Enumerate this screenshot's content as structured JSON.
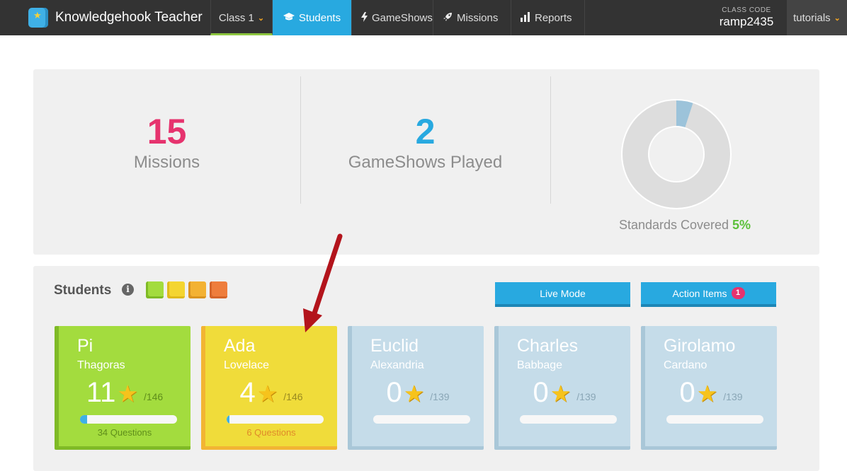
{
  "app": {
    "title": "Knowledgehook Teacher"
  },
  "nav": {
    "class_label": "Class 1",
    "students": "Students",
    "gameshows": "GameShows",
    "missions": "Missions",
    "reports": "Reports",
    "class_code_label": "CLASS CODE",
    "class_code": "ramp2435",
    "tutorials": "tutorials"
  },
  "stats": {
    "missions_count": "15",
    "missions_label": "Missions",
    "gameshows_count": "2",
    "gameshows_label": "GameShows Played",
    "standards_label": "Standards Covered",
    "standards_pct": "5%",
    "standards_fraction": 0.05
  },
  "students": {
    "title": "Students",
    "live_mode": "Live Mode",
    "action_items": "Action Items",
    "action_items_count": "1",
    "cards": [
      {
        "first": "Pi",
        "last": "Thagoras",
        "score": "11",
        "total": "/146",
        "progress": 0.075,
        "questions": "34 Questions",
        "color": "green"
      },
      {
        "first": "Ada",
        "last": "Lovelace",
        "score": "4",
        "total": "/146",
        "progress": 0.027,
        "questions": "6 Questions",
        "color": "yellow"
      },
      {
        "first": "Euclid",
        "last": "Alexandria",
        "score": "0",
        "total": "/139",
        "progress": 0,
        "questions": "",
        "color": "blue"
      },
      {
        "first": "Charles",
        "last": "Babbage",
        "score": "0",
        "total": "/139",
        "progress": 0,
        "questions": "",
        "color": "blue"
      },
      {
        "first": "Girolamo",
        "last": "Cardano",
        "score": "0",
        "total": "/139",
        "progress": 0,
        "questions": "",
        "color": "blue"
      }
    ]
  },
  "colors": {
    "accent": "#28a9e0",
    "missions": "#e6336e",
    "standards": "#5cc13a",
    "donut_track": "#dddddd",
    "donut_fill": "#9cc3da"
  }
}
